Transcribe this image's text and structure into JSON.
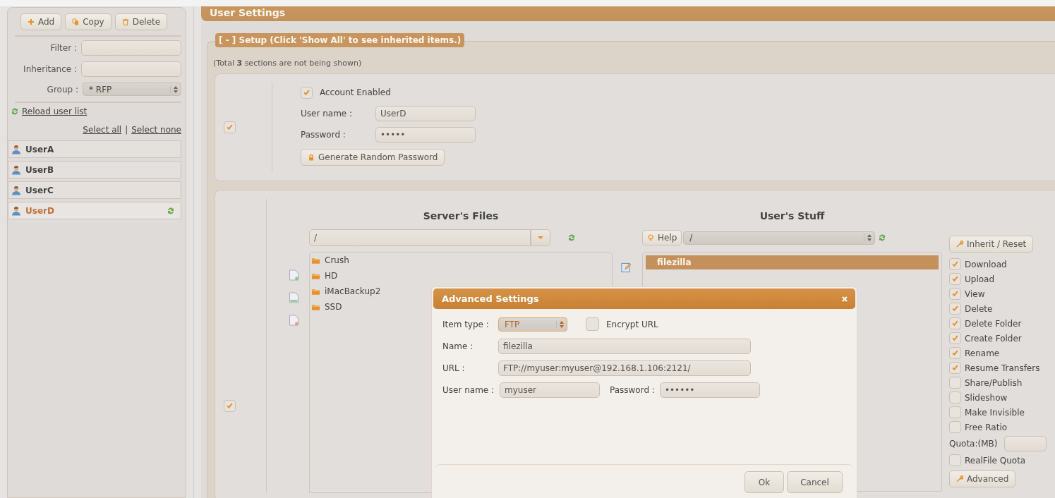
{
  "sidebar": {
    "toolbar": [
      {
        "kind": "add",
        "label": "Add"
      },
      {
        "kind": "copy",
        "label": "Copy"
      },
      {
        "kind": "delete",
        "label": "Delete"
      }
    ],
    "filter_label": "Filter :",
    "inheritance_label": "Inheritance :",
    "group_label": "Group :",
    "group_value": "* RFP",
    "reload_link": "Reload user list",
    "select_all": "Select all",
    "select_separator": "|",
    "select_none": "Select none",
    "users": [
      {
        "name": "UserA",
        "selected": false
      },
      {
        "name": "UserB",
        "selected": false
      },
      {
        "name": "UserC",
        "selected": false
      },
      {
        "name": "UserD",
        "selected": true
      }
    ]
  },
  "header": {
    "title": "User Settings"
  },
  "setup": {
    "legend": "[ - ] Setup (Click 'Show All' to see inherited items.)",
    "note": "(Total **3** sections are not being shown)"
  },
  "account": {
    "section_checked": true,
    "enabled": {
      "label": "Account Enabled",
      "checked": true
    },
    "username_label": "User name :",
    "username": "UserD",
    "password_label": "Password :",
    "password": "•••••",
    "generate_button": "Generate Random Password"
  },
  "files": {
    "section_checked": true,
    "server": {
      "title": "Server's Files",
      "path": "/",
      "items": [
        "Crush",
        "HD",
        "iMacBackup2",
        "SSD"
      ]
    },
    "user": {
      "title": "User's Stuff",
      "help_button": "Help",
      "path": "/",
      "items": [
        {
          "name": "filezilla",
          "selected": true
        }
      ]
    },
    "inherit_button": "Inherit / Reset",
    "permissions": [
      {
        "label": "Download",
        "checked": true
      },
      {
        "label": "Upload",
        "checked": true
      },
      {
        "label": "View",
        "checked": true
      },
      {
        "label": "Delete",
        "checked": true
      },
      {
        "label": "Delete Folder",
        "checked": true
      },
      {
        "label": "Create Folder",
        "checked": true
      },
      {
        "label": "Rename",
        "checked": true
      },
      {
        "label": "Resume Transfers",
        "checked": true
      },
      {
        "label": "Share/Publish",
        "checked": false
      },
      {
        "label": "Slideshow",
        "checked": false
      },
      {
        "label": "Make Invisible",
        "checked": false
      },
      {
        "label": "Free Ratio",
        "checked": false
      }
    ],
    "quota_label": "Quota:(MB)",
    "realfile_quota": {
      "label": "RealFile Quota",
      "checked": false
    },
    "advanced_button": "Advanced"
  },
  "dialog": {
    "title": "Advanced Settings",
    "item_type_label": "Item type :",
    "item_type": "FTP",
    "encrypt_url": {
      "label": "Encrypt URL",
      "checked": false
    },
    "name_label": "Name :",
    "name": "filezilla",
    "url_label": "URL :",
    "url": "FTP://myuser:myuser@192.168.1.106:2121/",
    "username_label": "User name :",
    "username": "myuser",
    "password_label": "Password :",
    "password": "••••••",
    "ok_button": "Ok",
    "cancel_button": "Cancel"
  }
}
